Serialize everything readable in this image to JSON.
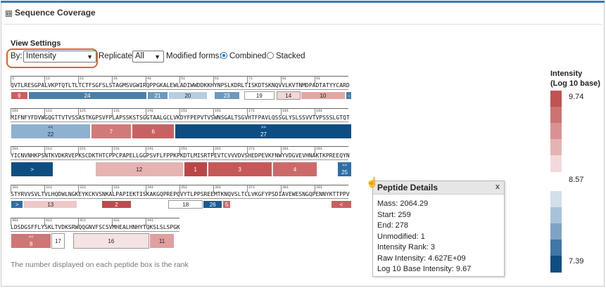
{
  "panel": {
    "title": "Sequence Coverage",
    "collapse_glyph": "⊟"
  },
  "view_settings": {
    "title": "View Settings",
    "by_label": "By:",
    "by_value": "Intensity",
    "replicate_label": "Replicate:",
    "replicate_value": "All",
    "modified_label": "Modified forms:",
    "combined_label": "Combined",
    "stacked_label": "Stacked"
  },
  "rows": [
    {
      "seq": "QVTLRESGPALVKPTQTLTLTCTFSGFSLSTAGMSVGWIRQPPGKALEWLADIWWDDKKHYNPSLKDRLTISKDTSKNQVVLKVTNMDPADTATYYCARD",
      "ticks": [
        "1",
        "11",
        "21",
        "31",
        "41",
        "51",
        "61",
        "71",
        "81",
        "91"
      ]
    },
    {
      "seq": "MIFNFYFDVWGQGTTVTVSSASTKGPSVFPLAPSSKSTSGGTAALGCLVKDYFPEPVTVSWNSGALTSGVHTFPAVLQSSGLYSLSSVVTVPSSSLGTQT",
      "ticks": [
        "101",
        "111",
        "121",
        "131",
        "141",
        "151",
        "161",
        "171",
        "181",
        "191"
      ]
    },
    {
      "seq": "YICNVNHKPSNTKVDKRVEPKSCDKTHTCPPCPAPELLGGPSVFLFPPKPKDTLMISRTPEVTCVVVDVSHEDPEVKFNWYVDGVEVHNAKTKPREEQYN",
      "ticks": [
        "201",
        "211",
        "221",
        "231",
        "241",
        "251",
        "261",
        "271",
        "281",
        "291"
      ]
    },
    {
      "seq": "STYRVVSVLTVLHQDWLNGKEYKCKVSNKALPAPIEKTISKAKGQPREPQVYTLPPSREEMTKNQVSLTCLVKGFYPSDIAVEWESNGQPENNYKTTPPV",
      "ticks": [
        "301",
        "311",
        "321",
        "331",
        "341",
        "351",
        "361",
        "371",
        "381",
        "391"
      ]
    },
    {
      "seq": "LDSDGSFFLYSKLTVDKSRWQQGNVFSCSVMHEALHNHYTQKSLSLSPGK",
      "ticks": [
        "401",
        "411",
        "421",
        "431",
        "441"
      ]
    }
  ],
  "peptides": [
    {
      "row": 0,
      "start": 0,
      "end": 8,
      "rank": "9",
      "color": "#c95f5f",
      "lane": 0
    },
    {
      "row": 0,
      "start": 8,
      "end": 63,
      "rank": "24",
      "color": "#4a7faa",
      "lane": 0
    },
    {
      "row": 0,
      "start": 63,
      "end": 73,
      "rank": "21",
      "color": "#6c99bf",
      "lane": 0
    },
    {
      "row": 0,
      "start": 73,
      "end": 91,
      "rank": "20",
      "color": "#b8cde0",
      "lane": 0,
      "dark": true
    },
    {
      "row": 0,
      "start": 94,
      "end": 106,
      "rank": "23",
      "color": "#6c99bf",
      "lane": 0
    },
    {
      "row": 0,
      "start": 108,
      "end": 122,
      "rank": "19",
      "color": "#ffffff",
      "lane": 0,
      "dark": true,
      "outlined": true
    },
    {
      "row": 0,
      "start": 123,
      "end": 134,
      "rank": "14",
      "color": "#f1d7d7",
      "lane": 0,
      "dark": true,
      "outlined": true
    },
    {
      "row": 0,
      "start": 134,
      "end": 155,
      "rank": "10",
      "color": "#e4a5a5",
      "lane": 0,
      "dark": true
    },
    {
      "row": 0,
      "start": 155,
      "end": 158,
      "rank": "-",
      "color": "#4a7faa",
      "lane": 0
    },
    {
      "row": 1,
      "start": 0,
      "end": 37,
      "rank": "22",
      "sub": "<<",
      "color": "#8fb1d0",
      "lane": 0,
      "dark": true,
      "tall": true
    },
    {
      "row": 1,
      "start": 37,
      "end": 56,
      "rank": "7",
      "color": "#d27979",
      "lane": 0,
      "tall": true
    },
    {
      "row": 1,
      "start": 56,
      "end": 76,
      "rank": "6",
      "color": "#c86262",
      "lane": 0,
      "tall": true
    },
    {
      "row": 1,
      "start": 76,
      "end": 158,
      "rank": "27",
      "sub": ">>",
      "color": "#0e4d82",
      "lane": 0,
      "tall": true
    },
    {
      "row": 2,
      "start": 0,
      "end": 20,
      "rank": ">",
      "color": "#0e4d82",
      "lane": 0,
      "tall": true
    },
    {
      "row": 2,
      "start": 39,
      "end": 80,
      "rank": "12",
      "color": "#e6b3b3",
      "lane": 0,
      "dark": true,
      "tall": true
    },
    {
      "row": 2,
      "start": 80,
      "end": 91,
      "rank": "1",
      "color": "#b94747",
      "lane": 0,
      "tall": true
    },
    {
      "row": 2,
      "start": 91,
      "end": 121,
      "rank": "3",
      "color": "#c45959",
      "lane": 0,
      "tall": true
    },
    {
      "row": 2,
      "start": 121,
      "end": 142,
      "rank": "4",
      "color": "#cc6a6a",
      "lane": 0,
      "tall": true
    },
    {
      "row": 2,
      "start": 151,
      "end": 158,
      "rank": "25",
      "sub": ">>",
      "color": "#2e6da3",
      "lane": 0,
      "tall": true
    },
    {
      "row": 3,
      "start": 0,
      "end": 6,
      "rank": ">",
      "color": "#2e6da3",
      "lane": 0
    },
    {
      "row": 3,
      "start": 6,
      "end": 31,
      "rank": "13",
      "color": "#eec7c7",
      "lane": 0,
      "dark": true
    },
    {
      "row": 3,
      "start": 42,
      "end": 56,
      "rank": "2",
      "color": "#bb4d4d",
      "lane": 0
    },
    {
      "row": 3,
      "start": 73,
      "end": 89,
      "rank": "18",
      "color": "#ffffff",
      "lane": 0,
      "dark": true,
      "outlined": true
    },
    {
      "row": 3,
      "start": 89,
      "end": 98,
      "rank": "26",
      "color": "#1a5a91",
      "lane": 0
    },
    {
      "row": 3,
      "start": 98,
      "end": 102,
      "rank": "5",
      "color": "#cc6a6a",
      "lane": 0
    },
    {
      "row": 3,
      "start": 148,
      "end": 158,
      "rank": "<",
      "color": "#c95f5f",
      "lane": 0
    },
    {
      "row": 4,
      "start": 0,
      "end": 19,
      "rank": "8",
      "sub": "<<",
      "color": "#d07575",
      "lane": 0,
      "tall": true
    },
    {
      "row": 4,
      "start": 19,
      "end": 25,
      "rank": "17",
      "color": "#ffffff",
      "lane": 0,
      "dark": true,
      "outlined": true,
      "tall": true
    },
    {
      "row": 4,
      "start": 29,
      "end": 64,
      "rank": "16",
      "color": "#f5e2e2",
      "lane": 0,
      "dark": true,
      "outlined": true,
      "tall": true
    },
    {
      "row": 4,
      "start": 64,
      "end": 76,
      "rank": "11",
      "color": "#e0a0a0",
      "lane": 0,
      "dark": true,
      "tall": true
    }
  ],
  "legend": {
    "title_line1": "Intensity",
    "title_line2": "(Log 10 base)",
    "max": "9.74",
    "mid": "8.57",
    "min": "7.39",
    "red_shades": [
      "#c05353",
      "#cd7272",
      "#d99191",
      "#e6b3b3",
      "#f3dada"
    ],
    "blue_shades": [
      "#d3dfea",
      "#a9c2d9",
      "#7ea3c5",
      "#3f77a8",
      "#0e4d82"
    ]
  },
  "note": "The number displayed on each peptide box is the rank",
  "tooltip": {
    "title": "Peptide Details",
    "close": "x",
    "lines": [
      "Mass: 2064.29",
      "Start: 259",
      "End: 278",
      "Unmodified: 1",
      "Intensity Rank: 3",
      "Raw Intensity: 4.627E+09",
      "Log 10 Base Intensity: 9.67"
    ]
  }
}
